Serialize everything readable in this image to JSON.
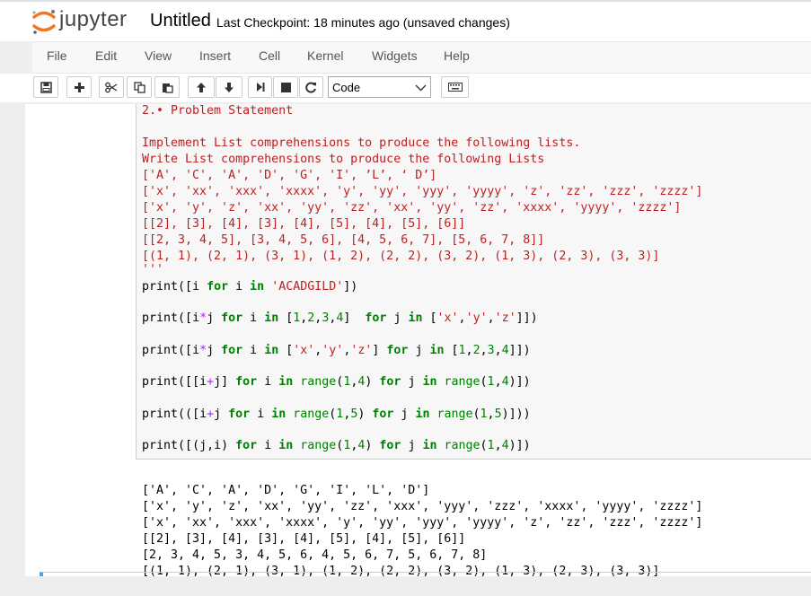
{
  "app": {
    "logo_text": "jupyter",
    "notebook_title": "Untitled",
    "checkpoint": "Last Checkpoint: 18 minutes ago (unsaved changes)"
  },
  "menu": [
    "File",
    "Edit",
    "View",
    "Insert",
    "Cell",
    "Kernel",
    "Widgets",
    "Help"
  ],
  "toolbar": {
    "buttons": [
      "save-icon",
      "add-icon",
      "cut-icon",
      "copy-icon",
      "paste-icon",
      "move-up-icon",
      "move-down-icon",
      "run-icon",
      "stop-icon",
      "restart-icon",
      "keyboard-icon"
    ],
    "cell_type": "Code"
  },
  "cell": {
    "docstring": [
      "2.• Problem Statement",
      "",
      "Implement List comprehensions to produce the following lists.",
      "Write List comprehensions to produce the following Lists",
      "['A', 'C', 'A', 'D', 'G', 'I', ’L’, ‘ D’]",
      "['x', 'xx', 'xxx', 'xxxx', 'y', 'yy', 'yyy', 'yyyy', 'z', 'zz', 'zzz', 'zzzz']",
      "['x', 'y', 'z', 'xx', 'yy', 'zz', 'xx', 'yy', 'zz', 'xxxx', 'yyyy', 'zzzz']",
      "[[2], [3], [4], [3], [4], [5], [4], [5], [6]]",
      "[[2, 3, 4, 5], [3, 4, 5, 6], [4, 5, 6, 7], [5, 6, 7, 8]]",
      "[(1, 1), (2, 1), (3, 1), (1, 2), (2, 2), (3, 2), (1, 3), (2, 3), (3, 3)]",
      "'''"
    ],
    "code_lines": [
      "print([i for i in 'ACADGILD'])",
      "print([i*j for i in [1,2,3,4]  for j in ['x','y','z']])",
      "print([i*j for i in ['x','y','z'] for j in [1,2,3,4]])",
      "print([[i+j] for i in range(1,4) for j in range(1,4)])",
      "print(([i+j for i in range(1,5) for j in range(1,5)]))",
      "print([(j,i) for i in range(1,4) for j in range(1,4)])"
    ]
  },
  "output": [
    "['A', 'C', 'A', 'D', 'G', 'I', 'L', 'D']",
    "['x', 'y', 'z', 'xx', 'yy', 'zz', 'xxx', 'yyy', 'zzz', 'xxxx', 'yyyy', 'zzzz']",
    "['x', 'xx', 'xxx', 'xxxx', 'y', 'yy', 'yyy', 'yyyy', 'z', 'zz', 'zzz', 'zzzz']",
    "[[2], [3], [4], [3], [4], [5], [4], [5], [6]]",
    "[2, 3, 4, 5, 3, 4, 5, 6, 4, 5, 6, 7, 5, 6, 7, 8]",
    "[(1, 1), (2, 1), (3, 1), (1, 2), (2, 2), (3, 2), (1, 3), (2, 3), (3, 3)]"
  ],
  "colors": {
    "string": "#ba2121",
    "keyword": "#008000",
    "operator": "#aa22ff",
    "logo_orange": "#f37626",
    "cell_focus": "#42a5f5"
  }
}
